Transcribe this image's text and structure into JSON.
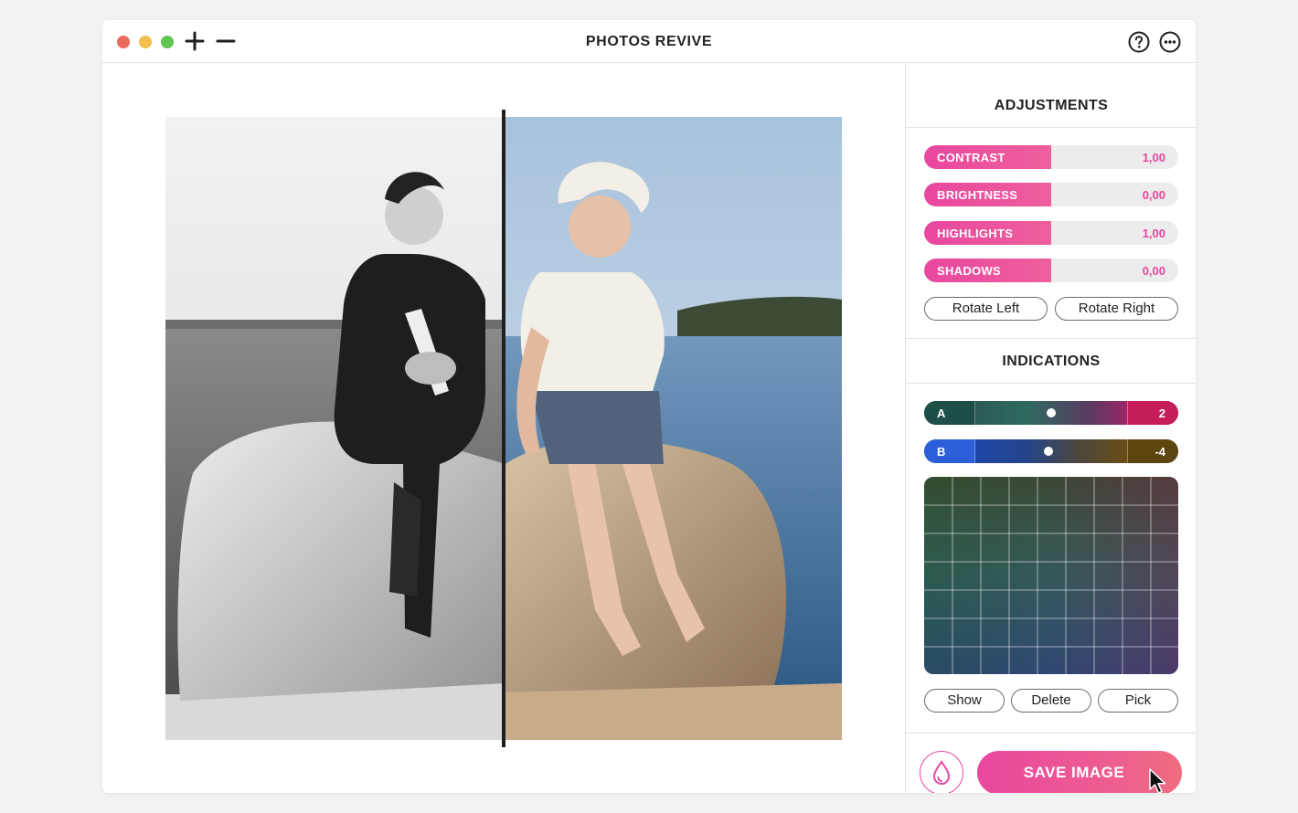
{
  "window": {
    "title": "PHOTOS REVIVE"
  },
  "titlebar": {
    "icons": [
      "close-dot",
      "minimize-dot",
      "zoom-dot",
      "plus-icon",
      "minus-icon",
      "help-icon",
      "more-icon"
    ]
  },
  "adjustments": {
    "title": "ADJUSTMENTS",
    "sliders": [
      {
        "label": "CONTRAST",
        "value": "1,00",
        "fill_fraction": 0.5
      },
      {
        "label": "BRIGHTNESS",
        "value": "0,00",
        "fill_fraction": 0.5
      },
      {
        "label": "HIGHLIGHTS",
        "value": "1,00",
        "fill_fraction": 0.5
      },
      {
        "label": "SHADOWS",
        "value": "0,00",
        "fill_fraction": 0.5
      }
    ],
    "rotate_left": "Rotate Left",
    "rotate_right": "Rotate Right"
  },
  "indications": {
    "title": "INDICATIONS",
    "a": {
      "label": "A",
      "value": "2",
      "knob_fraction": 0.5
    },
    "b": {
      "label": "B",
      "value": "-4",
      "knob_fraction": 0.48
    },
    "show": "Show",
    "delete": "Delete",
    "pick": "Pick"
  },
  "footer": {
    "save_label": "SAVE IMAGE"
  },
  "colors": {
    "accent": "#e8479e",
    "accent_light": "#ef6c7f",
    "slider_track": "#ececec",
    "divider": "#1f1f1f"
  }
}
